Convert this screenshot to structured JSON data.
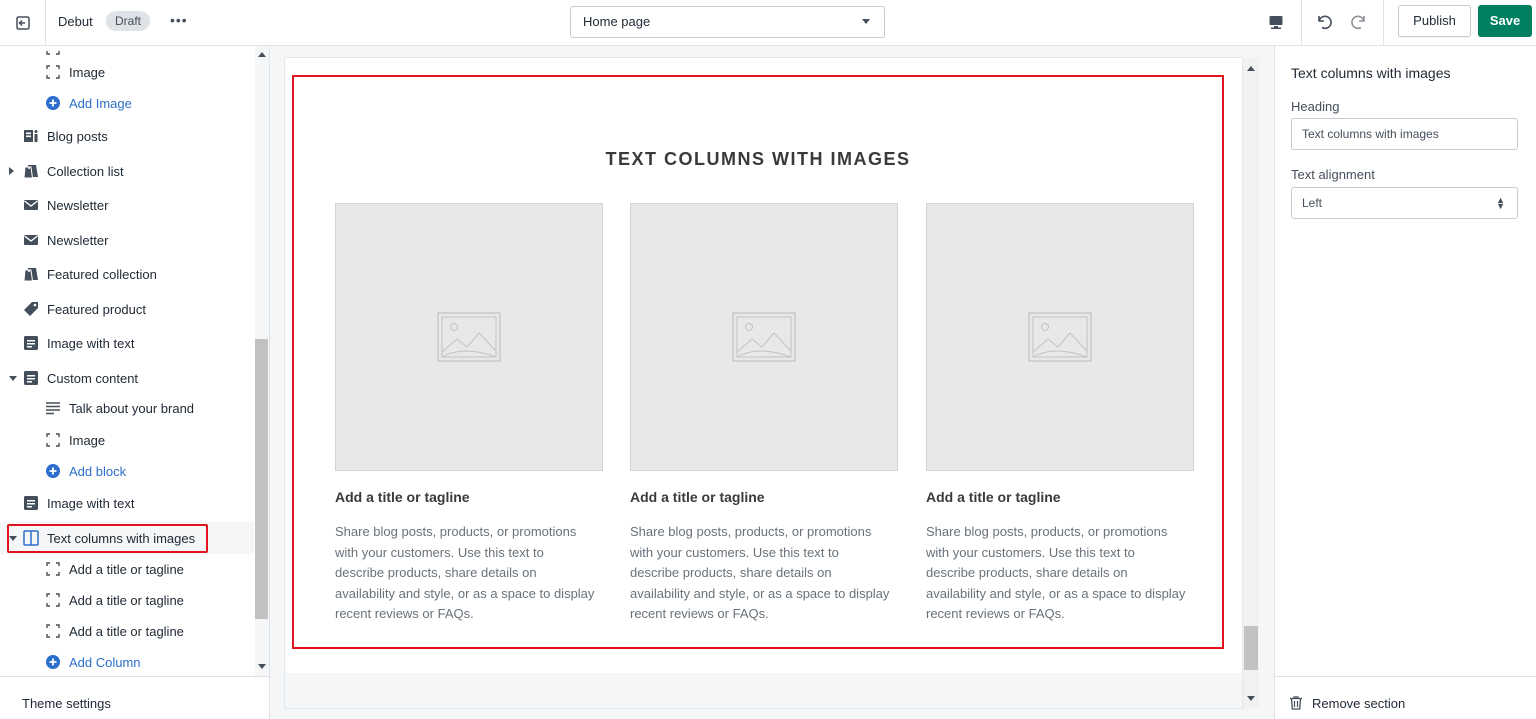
{
  "topbar": {
    "theme_name": "Debut",
    "status_badge": "Draft",
    "more_label": "•••",
    "page_selector": "Home page",
    "publish_label": "Publish",
    "save_label": "Save",
    "save_color": "#008060"
  },
  "sidebar": {
    "items": [
      {
        "label": "Image",
        "icon": "image-block-icon"
      },
      {
        "label": "Add Image",
        "icon": "add-circle-icon"
      },
      {
        "label": "Blog posts",
        "icon": "blog-icon"
      },
      {
        "label": "Collection list",
        "icon": "collection-icon"
      },
      {
        "label": "Newsletter",
        "icon": "envelope-icon"
      },
      {
        "label": "Newsletter",
        "icon": "envelope-icon"
      },
      {
        "label": "Featured collection",
        "icon": "collection-icon"
      },
      {
        "label": "Featured product",
        "icon": "tag-icon"
      },
      {
        "label": "Image with text",
        "icon": "section-icon"
      },
      {
        "label": "Custom content",
        "icon": "section-icon"
      },
      {
        "label": "Talk about your brand",
        "icon": "text-lines-icon"
      },
      {
        "label": "Image",
        "icon": "image-block-icon"
      },
      {
        "label": "Add block",
        "icon": "add-circle-icon"
      },
      {
        "label": "Image with text",
        "icon": "section-icon"
      },
      {
        "label": "Text columns with images",
        "icon": "columns-icon"
      },
      {
        "label": "Add a title or tagline",
        "icon": "image-block-icon"
      },
      {
        "label": "Add a title or tagline",
        "icon": "image-block-icon"
      },
      {
        "label": "Add a title or tagline",
        "icon": "image-block-icon"
      },
      {
        "label": "Add Column",
        "icon": "add-circle-icon"
      }
    ],
    "theme_settings": "Theme settings"
  },
  "preview": {
    "section_title": "TEXT COLUMNS WITH IMAGES",
    "columns": [
      {
        "title": "Add a title or tagline",
        "text": "Share blog posts, products, or promotions with your customers. Use this text to describe products, share details on availability and style, or as a space to display recent reviews or FAQs."
      },
      {
        "title": "Add a title or tagline",
        "text": "Share blog posts, products, or promotions with your customers. Use this text to describe products, share details on availability and style, or as a space to display recent reviews or FAQs."
      },
      {
        "title": "Add a title or tagline",
        "text": "Share blog posts, products, or promotions with your customers. Use this text to describe products, share details on availability and style, or as a space to display recent reviews or FAQs."
      }
    ],
    "highlight_color": "#e0141e"
  },
  "panel": {
    "title": "Text columns with images",
    "heading_label": "Heading",
    "heading_value": "Text columns with images",
    "alignment_label": "Text alignment",
    "alignment_value": "Left",
    "remove_label": "Remove section"
  }
}
